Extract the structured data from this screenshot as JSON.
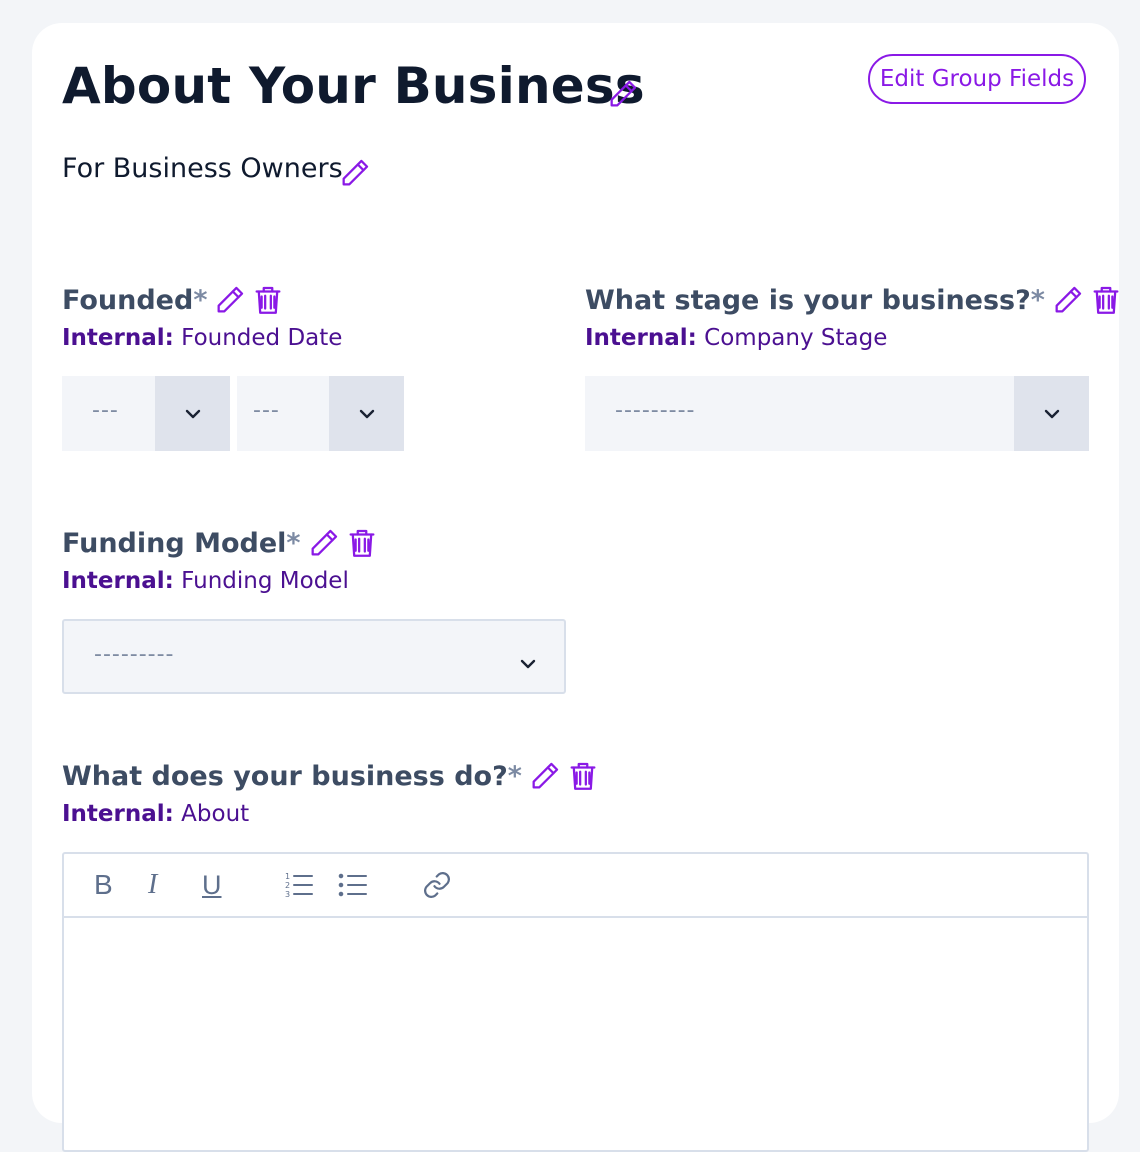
{
  "group": {
    "title": "About Your Business",
    "subtitle": "For Business Owners",
    "edit_group_fields_label": "Edit Group Fields"
  },
  "internal_prefix": "Internal:",
  "required_marker": "*",
  "fields": {
    "founded": {
      "label": "Founded",
      "internal_name": "Founded Date",
      "month_value": "---",
      "year_value": "---"
    },
    "stage": {
      "label": "What stage is your business?",
      "internal_name": "Company Stage",
      "value": "---------"
    },
    "funding": {
      "label": "Funding Model",
      "internal_name": "Funding Model",
      "value": "---------"
    },
    "about": {
      "label": "What does your business do?",
      "internal_name": "About",
      "value": ""
    }
  },
  "editor_toolbar": {
    "bold": "B",
    "italic": "I",
    "underline": "U",
    "items": [
      "bold-icon",
      "italic-icon",
      "underline-icon",
      "ordered-list-icon",
      "bullet-list-icon",
      "link-icon"
    ]
  },
  "colors": {
    "accent": "#8a19e6",
    "internal_text": "#4b1091",
    "label_text": "#3d4c63",
    "title_text": "#0f1a2e",
    "select_bg": "#f3f5f9",
    "select_arrow_bg": "#dfe3ec",
    "page_bg": "#f3f5f8"
  }
}
